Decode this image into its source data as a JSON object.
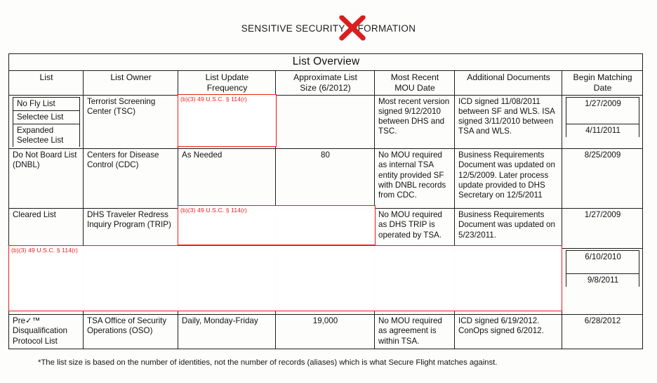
{
  "document": {
    "classification_banner": "SENSITIVE SECURITY INFORMATION",
    "redaction_marker_icon": "red-x-stamp",
    "footnote": "*The list size is based on the number of identities, not the number of records (aliases) which is what Secure Flight matches against."
  },
  "table": {
    "title": "List Overview",
    "columns": [
      "List",
      "List Owner",
      "List Update Frequency",
      "Approximate List Size (6/2012)",
      "Most Recent MOU Date",
      "Additional Documents",
      "Begin Matching Date"
    ],
    "column_lines": {
      "c1_l1": "List",
      "c2_l1": "List Owner",
      "c3_l1": "List Update",
      "c3_l2": "Frequency",
      "c4_l1": "Approximate List",
      "c4_l2": "Size (6/2012)",
      "c5_l1": "Most Recent",
      "c5_l2": "MOU Date",
      "c6_l1": "Additional Documents",
      "c7_l1": "Begin Matching",
      "c7_l2": "Date"
    },
    "redaction_code": "(b)(3) 49 U.S.C. § 114(r)",
    "rows": [
      {
        "list_lines": [
          "No Fly List",
          "Selectee List",
          "Expanded Selectee List"
        ],
        "owner": "Terrorist Screening Center (TSC)",
        "update_frequency": "(b)(3) 49 U.S.C. § 114(r)",
        "update_frequency_redacted": true,
        "approx_size": "",
        "approx_size_redacted": true,
        "most_recent_mou": "Most recent version signed 9/12/2010 between DHS and TSC.",
        "additional_documents": "ICD signed 11/08/2011 between SF and WLS. ISA signed 3/11/2010 between TSA and WLS.",
        "begin_matching_dates": [
          "1/27/2009",
          "4/11/2011"
        ]
      },
      {
        "list_lines": [
          "Do Not Board List (DNBL)"
        ],
        "owner": "Centers for Disease Control (CDC)",
        "update_frequency": "As Needed",
        "update_frequency_redacted": false,
        "approx_size": "80",
        "approx_size_redacted": false,
        "most_recent_mou": "No MOU required as internal TSA entity provided SF with DNBL records from CDC.",
        "additional_documents": "Business Requirements Document was updated on 12/5/2009. Later process update provided to DHS Secretary on 12/5/2011",
        "begin_matching_dates": [
          "8/25/2009"
        ]
      },
      {
        "list_lines": [
          "Cleared List"
        ],
        "owner": "DHS Traveler Redress Inquiry Program (TRIP)",
        "update_frequency": "(b)(3) 49 U.S.C. § 114(r)",
        "update_frequency_redacted": true,
        "approx_size": "",
        "approx_size_redacted": true,
        "most_recent_mou": "No MOU required as DHS TRIP is operated by TSA.",
        "additional_documents": "Business Requirements Document was updated on 5/23/2011.",
        "begin_matching_dates": [
          "1/27/2009"
        ]
      },
      {
        "list_lines": [],
        "owner": "",
        "update_frequency": "",
        "fully_redacted": true,
        "redaction_code": "(b)(3) 49 U.S.C. § 114(r)",
        "approx_size": "",
        "most_recent_mou": "",
        "additional_documents": "",
        "begin_matching_dates": [
          "6/10/2010",
          "9/8/2011"
        ]
      },
      {
        "list_lines": [
          "Pre✓™ Disqualification Protocol List"
        ],
        "list_line_1": "Pre✓™",
        "list_line_2": "Disqualification",
        "list_line_3": "Protocol List",
        "owner": "TSA Office of Security Operations (OSO)",
        "update_frequency": "Daily, Monday-Friday",
        "update_frequency_redacted": false,
        "approx_size": "19,000",
        "approx_size_redacted": false,
        "most_recent_mou": "No MOU required as agreement is within TSA.",
        "additional_documents": "ICD signed 6/19/2012. ConOps signed 6/2012.",
        "begin_matching_dates": [
          "6/28/2012"
        ]
      }
    ]
  },
  "colors": {
    "redaction_red": "#ee1b1b",
    "title_background": "#e8e6e2",
    "border": "#1d1d1d",
    "text": "#111111"
  }
}
